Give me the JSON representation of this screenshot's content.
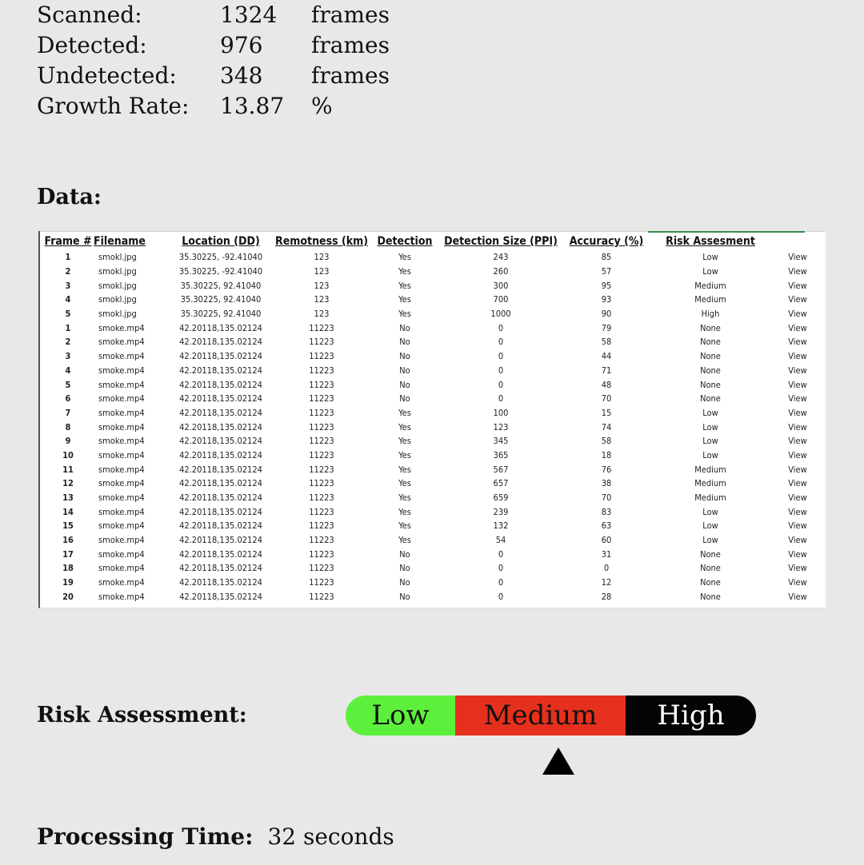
{
  "summary": {
    "rows": [
      {
        "label": "Scanned:",
        "value": "1324",
        "unit": "frames"
      },
      {
        "label": "Detected:",
        "value": "976",
        "unit": "frames"
      },
      {
        "label": "Undetected:",
        "value": "348",
        "unit": "frames"
      },
      {
        "label": "Growth Rate:",
        "value": "13.87",
        "unit": "%"
      }
    ]
  },
  "data_heading": "Data:",
  "table": {
    "headers": [
      "Frame #",
      "Filename",
      "Location (DD)",
      "Remotness (km)",
      "Detection",
      "Detection Size (PPI)",
      "Accuracy (%)",
      "Risk Assesment",
      ""
    ],
    "rows": [
      [
        "1",
        "smokl.jpg",
        "35.30225, -92.41040",
        "123",
        "Yes",
        "243",
        "85",
        "Low",
        "View"
      ],
      [
        "2",
        "smokl.jpg",
        "35.30225, -92.41040",
        "123",
        "Yes",
        "260",
        "57",
        "Low",
        "View"
      ],
      [
        "3",
        "smokl.jpg",
        "35.30225, 92.41040",
        "123",
        "Yes",
        "300",
        "95",
        "Medium",
        "View"
      ],
      [
        "4",
        "smokl.jpg",
        "35.30225, 92.41040",
        "123",
        "Yes",
        "700",
        "93",
        "Medium",
        "View"
      ],
      [
        "5",
        "smokl.jpg",
        "35.30225, 92.41040",
        "123",
        "Yes",
        "1000",
        "90",
        "High",
        "View"
      ],
      [
        "1",
        "smoke.mp4",
        "42.20118,135.02124",
        "11223",
        "No",
        "0",
        "79",
        "None",
        "View"
      ],
      [
        "2",
        "smoke.mp4",
        "42.20118,135.02124",
        "11223",
        "No",
        "0",
        "58",
        "None",
        "View"
      ],
      [
        "3",
        "smoke.mp4",
        "42.20118,135.02124",
        "11223",
        "No",
        "0",
        "44",
        "None",
        "View"
      ],
      [
        "4",
        "smoke.mp4",
        "42.20118,135.02124",
        "11223",
        "No",
        "0",
        "71",
        "None",
        "View"
      ],
      [
        "5",
        "smoke.mp4",
        "42.20118,135.02124",
        "11223",
        "No",
        "0",
        "48",
        "None",
        "View"
      ],
      [
        "6",
        "smoke.mp4",
        "42.20118,135.02124",
        "11223",
        "No",
        "0",
        "70",
        "None",
        "View"
      ],
      [
        "7",
        "smoke.mp4",
        "42.20118,135.02124",
        "11223",
        "Yes",
        "100",
        "15",
        "Low",
        "View"
      ],
      [
        "8",
        "smoke.mp4",
        "42.20118,135.02124",
        "11223",
        "Yes",
        "123",
        "74",
        "Low",
        "View"
      ],
      [
        "9",
        "smoke.mp4",
        "42.20118,135.02124",
        "11223",
        "Yes",
        "345",
        "58",
        "Low",
        "View"
      ],
      [
        "10",
        "smoke.mp4",
        "42.20118,135.02124",
        "11223",
        "Yes",
        "365",
        "18",
        "Low",
        "View"
      ],
      [
        "11",
        "smoke.mp4",
        "42.20118,135.02124",
        "11223",
        "Yes",
        "567",
        "76",
        "Medium",
        "View"
      ],
      [
        "12",
        "smoke.mp4",
        "42.20118,135.02124",
        "11223",
        "Yes",
        "657",
        "38",
        "Medium",
        "View"
      ],
      [
        "13",
        "smoke.mp4",
        "42.20118,135.02124",
        "11223",
        "Yes",
        "659",
        "70",
        "Medium",
        "View"
      ],
      [
        "14",
        "smoke.mp4",
        "42.20118,135.02124",
        "11223",
        "Yes",
        "239",
        "83",
        "Low",
        "View"
      ],
      [
        "15",
        "smoke.mp4",
        "42.20118,135.02124",
        "11223",
        "Yes",
        "132",
        "63",
        "Low",
        "View"
      ],
      [
        "16",
        "smoke.mp4",
        "42.20118,135.02124",
        "11223",
        "Yes",
        "54",
        "60",
        "Low",
        "View"
      ],
      [
        "17",
        "smoke.mp4",
        "42.20118,135.02124",
        "11223",
        "No",
        "0",
        "31",
        "None",
        "View"
      ],
      [
        "18",
        "smoke.mp4",
        "42.20118,135.02124",
        "11223",
        "No",
        "0",
        "0",
        "None",
        "View"
      ],
      [
        "19",
        "smoke.mp4",
        "42.20118,135.02124",
        "11223",
        "No",
        "0",
        "12",
        "None",
        "View"
      ],
      [
        "20",
        "smoke.mp4",
        "42.20118,135.02124",
        "11223",
        "No",
        "0",
        "28",
        "None",
        "View"
      ]
    ]
  },
  "risk": {
    "label": "Risk Assessment:",
    "levels": [
      "Low",
      "Medium",
      "High"
    ],
    "selected": "Medium",
    "colors": {
      "low": "#5cf03c",
      "medium": "#e6301e",
      "high": "#050505"
    }
  },
  "processing": {
    "label": "Processing Time:",
    "value": "32 seconds"
  }
}
